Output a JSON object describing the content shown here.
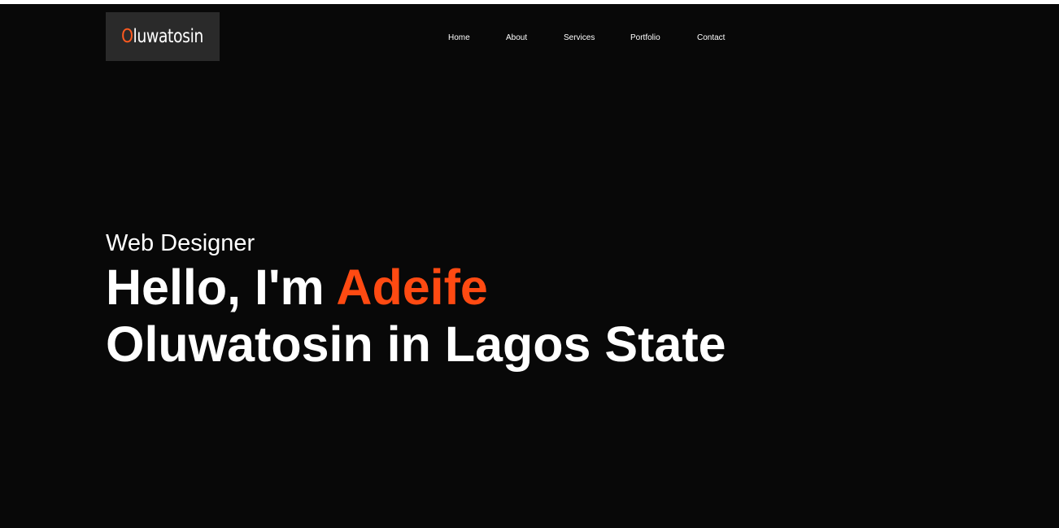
{
  "logo": {
    "first_letter": "O",
    "rest": "luwatosin"
  },
  "nav": {
    "home": "Home",
    "about": "About",
    "services": "Services",
    "portfolio": "Portfolio",
    "contact": "Contact"
  },
  "hero": {
    "subtitle": "Web Designer",
    "headline_prefix": "Hello, I'm ",
    "headline_name": "Adeife",
    "headline_line2": "Oluwatosin in Lagos State"
  },
  "colors": {
    "background": "#080808",
    "logo_background": "#2a2a2a",
    "accent": "#ff4a12",
    "text": "#ffffff"
  }
}
